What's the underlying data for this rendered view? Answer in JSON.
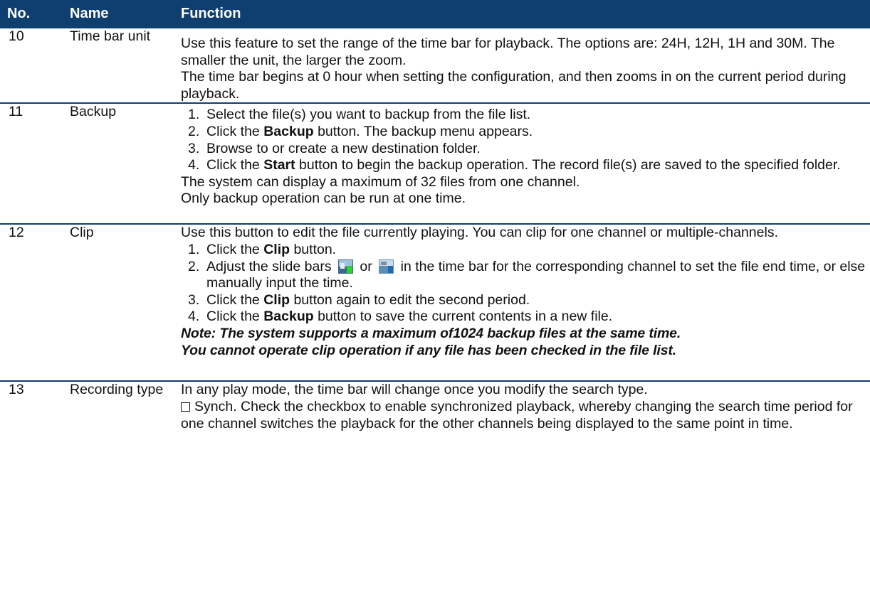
{
  "header": {
    "no": "No.",
    "name": "Name",
    "function": "Function"
  },
  "rows": [
    {
      "no": "10",
      "name": "Time bar unit",
      "p1": "Use this feature to set the range of the time bar for playback. The options are: 24H, 12H, 1H and 30M. The smaller the unit, the larger the zoom.",
      "p2": "The time bar begins at 0 hour when setting the configuration, and then zooms in on the current period during playback."
    },
    {
      "no": "11",
      "name": "Backup",
      "steps": [
        {
          "num": "1.",
          "pre": "Select the file(s) you want to backup from the file list.",
          "bold": "",
          "post": ""
        },
        {
          "num": "2.",
          "pre": "Click the ",
          "bold": "Backup",
          "post": " button. The backup menu appears."
        },
        {
          "num": "3.",
          "pre": "Browse to or create a new destination folder.",
          "bold": "",
          "post": ""
        },
        {
          "num": "4.",
          "pre": "Click the ",
          "bold": "Start",
          "post": " button to begin the backup operation. The record file(s) are saved to the specified folder."
        }
      ],
      "p1": "The system can display a maximum of 32 files from one channel.",
      "p2": "Only backup operation can be run at one time."
    },
    {
      "no": "12",
      "name": "Clip",
      "intro": "Use this button to edit the file currently playing. You can clip for one channel or multiple-channels.",
      "step1": {
        "num": "1.",
        "pre": "Click the ",
        "bold": "Clip",
        "post": " button."
      },
      "step2": {
        "num": "2.",
        "pre": "Adjust the slide bars ",
        "mid": " or ",
        "post": " in the time bar for the corresponding channel to set the file end time, or else manually input the time."
      },
      "step3": {
        "num": "3.",
        "pre": "Click the ",
        "bold": "Clip",
        "post": " button again to edit the second period."
      },
      "step4": {
        "num": "4.",
        "pre": "Click the ",
        "bold": "Backup",
        "post": " button to save the current contents in a new file."
      },
      "note1": "Note: The system supports a maximum of1024 backup files at the same time.",
      "note2": "You cannot operate clip operation if any file has been checked in the file list."
    },
    {
      "no": "13",
      "name": "Recording type",
      "p1": "In any play mode, the time bar will change once you modify the search type.",
      "p2": "Synch. Check the checkbox to enable synchronized playback, whereby changing the search time period for one channel switches the playback for the other channels being displayed to the same point in time."
    }
  ],
  "colors": {
    "header_bg": "#0e3f6e",
    "header_text": "#ffffff",
    "rule": "#0e3f6e"
  },
  "icons": [
    "checkbox-icon",
    "slide-bar-start-icon",
    "slide-bar-end-icon"
  ]
}
